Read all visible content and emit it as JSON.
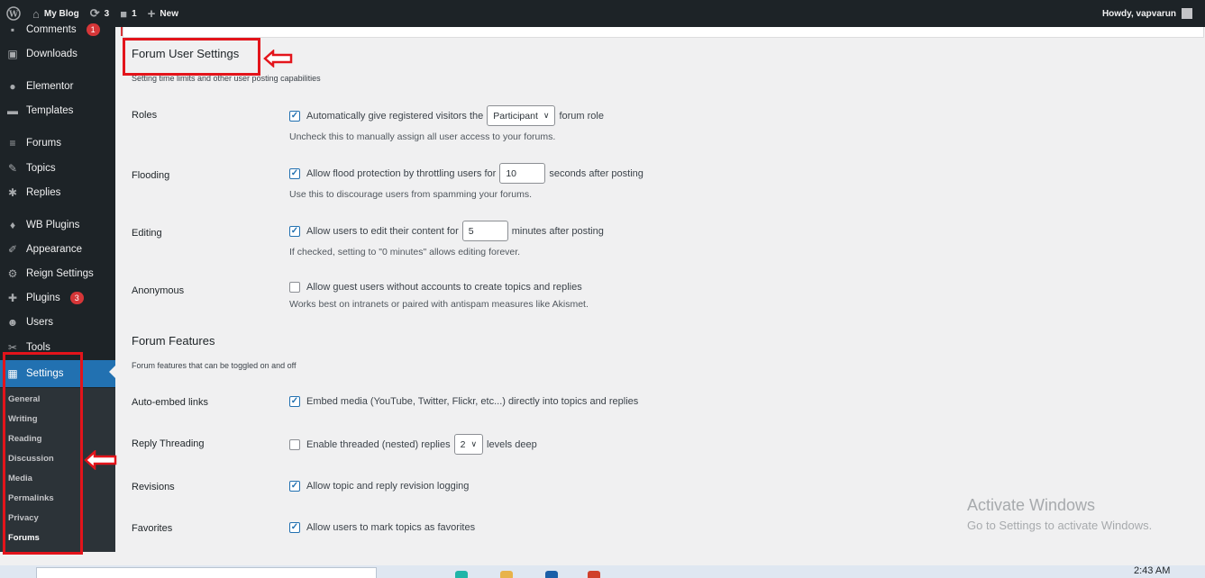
{
  "adminbar": {
    "site_name": "My Blog",
    "updates_count": "3",
    "comments_count": "1",
    "new_label": "New",
    "howdy": "Howdy, vapvarun"
  },
  "sidebar": {
    "items": [
      {
        "label": "Comments",
        "badge": "1",
        "icon": "comment-icon"
      },
      {
        "label": "Downloads",
        "icon": "download-icon"
      },
      {
        "label": "Elementor",
        "icon": "elementor-icon"
      },
      {
        "label": "Templates",
        "icon": "folder-icon"
      },
      {
        "label": "Forums",
        "icon": "forums-icon"
      },
      {
        "label": "Topics",
        "icon": "topics-icon"
      },
      {
        "label": "Replies",
        "icon": "replies-icon"
      },
      {
        "label": "WB Plugins",
        "icon": "lightbulb-icon"
      },
      {
        "label": "Appearance",
        "icon": "brush-icon"
      },
      {
        "label": "Reign Settings",
        "icon": "gear-icon"
      },
      {
        "label": "Plugins",
        "badge": "3",
        "icon": "plugin-icon"
      },
      {
        "label": "Users",
        "icon": "user-icon"
      },
      {
        "label": "Tools",
        "icon": "wrench-icon"
      },
      {
        "label": "Settings",
        "icon": "settings-icon"
      }
    ],
    "submenu": [
      "General",
      "Writing",
      "Reading",
      "Discussion",
      "Media",
      "Permalinks",
      "Privacy",
      "Forums"
    ]
  },
  "user_settings": {
    "title": "Forum User Settings",
    "description": "Setting time limits and other user posting capabilities",
    "roles": {
      "label": "Roles",
      "text_before": "Automatically give registered visitors the",
      "select_value": "Participant",
      "text_after": "forum role",
      "description": "Uncheck this to manually assign all user access to your forums."
    },
    "flooding": {
      "label": "Flooding",
      "text_before": "Allow flood protection by throttling users for",
      "input_value": "10",
      "text_after": "seconds after posting",
      "description": "Use this to discourage users from spamming your forums."
    },
    "editing": {
      "label": "Editing",
      "text_before": "Allow users to edit their content for",
      "input_value": "5",
      "text_after": "minutes after posting",
      "description": "If checked, setting to \"0 minutes\" allows editing forever."
    },
    "anonymous": {
      "label": "Anonymous",
      "text": "Allow guest users without accounts to create topics and replies",
      "description": "Works best on intranets or paired with antispam measures like Akismet."
    }
  },
  "features": {
    "title": "Forum Features",
    "description": "Forum features that can be toggled on and off",
    "auto_embed": {
      "label": "Auto-embed links",
      "text": "Embed media (YouTube, Twitter, Flickr, etc...) directly into topics and replies"
    },
    "threading": {
      "label": "Reply Threading",
      "text_before": "Enable threaded (nested) replies",
      "select_value": "2",
      "text_after": "levels deep"
    },
    "revisions": {
      "label": "Revisions",
      "text": "Allow topic and reply revision logging"
    },
    "favorites": {
      "label": "Favorites",
      "text": "Allow users to mark topics as favorites"
    }
  },
  "watermark": {
    "line1": "Activate Windows",
    "line2": "Go to Settings to activate Windows."
  },
  "taskbar": {
    "time": "2:43 AM"
  },
  "colors": {
    "accent": "#2271b1",
    "annotation": "#e3141b",
    "sidebar": "#1d2327"
  }
}
